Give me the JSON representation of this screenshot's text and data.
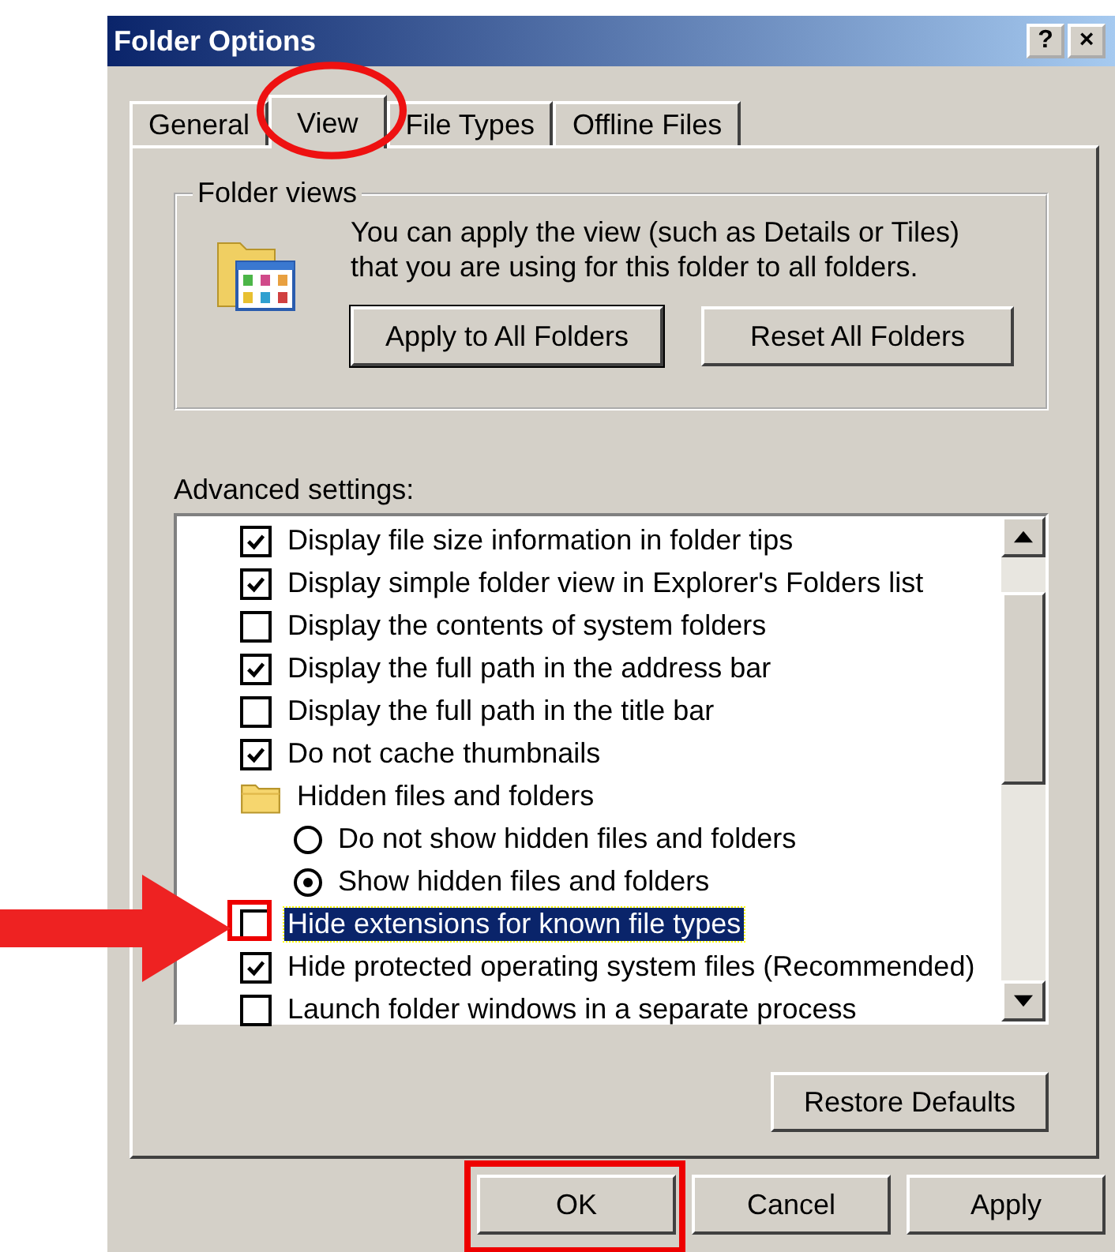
{
  "window": {
    "title": "Folder Options"
  },
  "title_buttons": [
    "?",
    "×"
  ],
  "tabs": [
    {
      "label": "General",
      "selected": false,
      "circled": false
    },
    {
      "label": "View",
      "selected": true,
      "circled": true
    },
    {
      "label": "File Types",
      "selected": false,
      "circled": false
    },
    {
      "label": "Offline Files",
      "selected": false,
      "circled": false
    }
  ],
  "folder_views": {
    "title": "Folder views",
    "text": "You can apply the view (such as Details or Tiles) that you are using for this folder to all folders.",
    "buttons": [
      {
        "label": "Apply to All Folders",
        "default": true
      },
      {
        "label": "Reset All Folders",
        "default": false
      }
    ]
  },
  "advanced": {
    "label": "Advanced settings:",
    "items": [
      {
        "kind": "checkbox",
        "label": "Display file size information in folder tips",
        "checked": true,
        "selected": false,
        "highlighted": false
      },
      {
        "kind": "checkbox",
        "label": "Display simple folder view in Explorer's Folders list",
        "checked": true,
        "selected": false,
        "highlighted": false
      },
      {
        "kind": "checkbox",
        "label": "Display the contents of system folders",
        "checked": false,
        "selected": false,
        "highlighted": false
      },
      {
        "kind": "checkbox",
        "label": "Display the full path in the address bar",
        "checked": true,
        "selected": false,
        "highlighted": false
      },
      {
        "kind": "checkbox",
        "label": "Display the full path in the title bar",
        "checked": false,
        "selected": false,
        "highlighted": false
      },
      {
        "kind": "checkbox",
        "label": "Do not cache thumbnails",
        "checked": true,
        "selected": false,
        "highlighted": false
      },
      {
        "kind": "folder",
        "label": "Hidden files and folders",
        "children": [
          {
            "kind": "radio",
            "label": "Do not show hidden files and folders",
            "checked": false
          },
          {
            "kind": "radio",
            "label": "Show hidden files and folders",
            "checked": true
          }
        ]
      },
      {
        "kind": "checkbox",
        "label": "Hide extensions for known file types",
        "checked": false,
        "selected": true,
        "highlighted": true
      },
      {
        "kind": "checkbox",
        "label": "Hide protected operating system files (Recommended)",
        "checked": true,
        "selected": false,
        "highlighted": false
      },
      {
        "kind": "checkbox",
        "label": "Launch folder windows in a separate process",
        "checked": false,
        "selected": false,
        "highlighted": false
      }
    ],
    "restore_button": "Restore Defaults"
  },
  "buttons": [
    {
      "label": "OK",
      "highlighted": true
    },
    {
      "label": "Cancel",
      "highlighted": false
    },
    {
      "label": "Apply",
      "highlighted": false
    }
  ]
}
